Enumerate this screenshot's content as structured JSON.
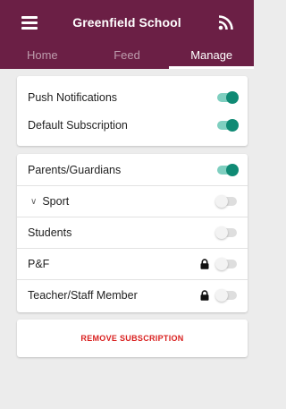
{
  "header": {
    "title": "Greenfield School",
    "menu_icon": "menu-icon",
    "feed_icon": "rss-feed-icon",
    "color": "#6b1f45"
  },
  "tabs": [
    {
      "label": "Home",
      "active": false
    },
    {
      "label": "Feed",
      "active": false
    },
    {
      "label": "Manage",
      "active": true
    }
  ],
  "settings": [
    {
      "label": "Push Notifications",
      "on": true
    },
    {
      "label": "Default Subscription",
      "on": true
    }
  ],
  "groups": [
    {
      "label": "Parents/Guardians",
      "on": true,
      "locked": false
    },
    {
      "label": "Sport",
      "on": false,
      "locked": false,
      "expandable": true
    },
    {
      "label": "Students",
      "on": false,
      "locked": false
    },
    {
      "label": "P&F",
      "on": false,
      "locked": true
    },
    {
      "label": "Teacher/Staff Member",
      "on": false,
      "locked": true
    }
  ],
  "actions": {
    "remove_label": "REMOVE SUBSCRIPTION",
    "remove_color": "#d9201f"
  },
  "colors": {
    "toggle_on": "#0f8a74",
    "toggle_on_track": "#7fcfc0",
    "background": "#ececec"
  }
}
